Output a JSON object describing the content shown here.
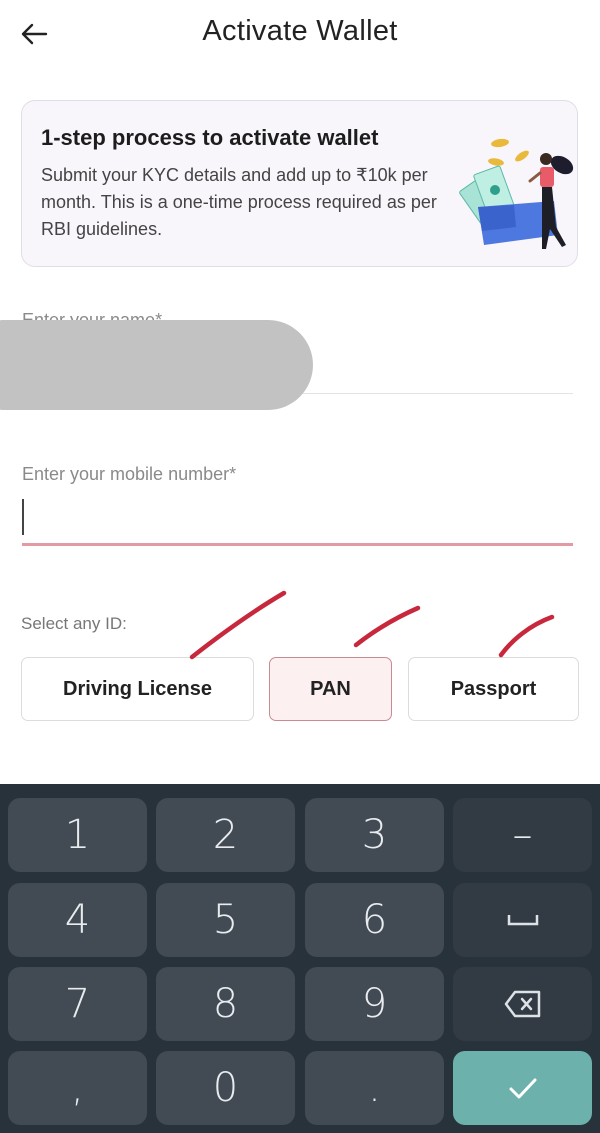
{
  "header": {
    "title": "Activate Wallet",
    "back_icon": "arrow-left-icon"
  },
  "info_card": {
    "title": "1-step process to activate wallet",
    "description": "Submit your KYC details and add up to ₹10k per month. This is a one-time process required as per RBI guidelines.",
    "illustration": "wallet-woman-illustration"
  },
  "form": {
    "name_field": {
      "label": "Enter your name*",
      "value": ""
    },
    "mobile_field": {
      "label": "Enter your mobile number*",
      "value": "",
      "focused": true
    },
    "id_section": {
      "label": "Select any ID:",
      "options": [
        {
          "label": "Driving License",
          "selected": false
        },
        {
          "label": "PAN",
          "selected": true
        },
        {
          "label": "Passport",
          "selected": false
        }
      ]
    }
  },
  "keyboard": {
    "rows": [
      [
        {
          "label": "1"
        },
        {
          "label": "2"
        },
        {
          "label": "3"
        },
        {
          "label": "–",
          "type": "fn"
        }
      ],
      [
        {
          "label": "4"
        },
        {
          "label": "5"
        },
        {
          "label": "6"
        },
        {
          "label": "",
          "icon": "space-icon",
          "type": "fn"
        }
      ],
      [
        {
          "label": "7"
        },
        {
          "label": "8"
        },
        {
          "label": "9"
        },
        {
          "label": "",
          "icon": "backspace-icon",
          "type": "fn"
        }
      ],
      [
        {
          "label": ","
        },
        {
          "label": "0"
        },
        {
          "label": "."
        },
        {
          "label": "",
          "icon": "checkmark-icon",
          "type": "ok"
        }
      ]
    ]
  },
  "colors": {
    "accent_red": "#e39aa3",
    "selected_bg": "#fdf0f1",
    "keyboard_bg": "#28323b",
    "key_bg": "#424a53",
    "confirm_key": "#6db1ac"
  }
}
